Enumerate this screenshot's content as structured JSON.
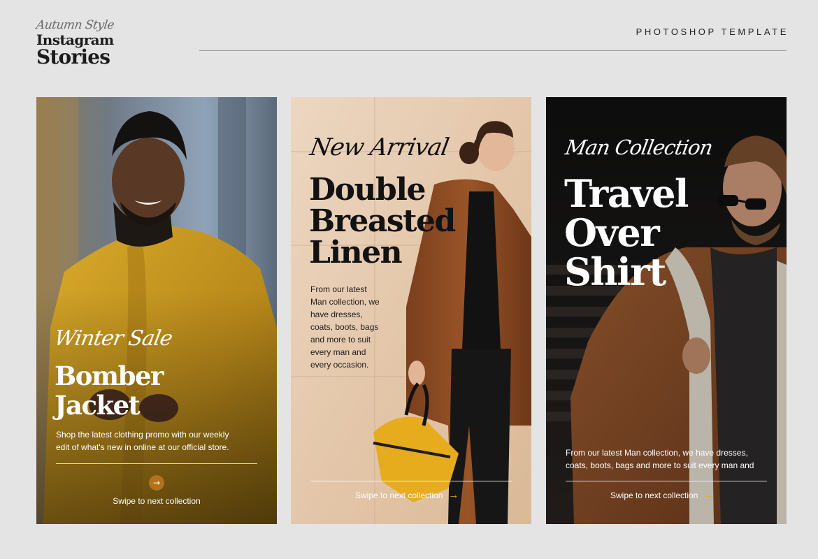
{
  "header": {
    "brand_script": "Autumn Style",
    "brand_line1": "Instagram",
    "brand_line2": "Stories",
    "tag": "PHOTOSHOP TEMPLATE"
  },
  "cards": [
    {
      "script": "Winter Sale",
      "headline": [
        "Bomber",
        "Jacket"
      ],
      "body": [
        "Shop the latest clothing promo with our weekly",
        "edit of what's new in online at our official store."
      ],
      "arrow_icon": "→",
      "swipe": "Swipe to next collection"
    },
    {
      "script": "New Arrival",
      "headline": [
        "Double",
        "Breasted",
        "Linen"
      ],
      "body": [
        "From our latest",
        "Man collection, we",
        "have dresses,",
        "coats, boots, bags",
        "and more to suit",
        "every man and",
        "every occasion."
      ],
      "swipe": "Swipe to next collection",
      "arrow_icon": "→"
    },
    {
      "script": "Man Collection",
      "headline": [
        "Travel",
        "Over",
        "Shirt"
      ],
      "body": [
        "From our latest Man collection, we have dresses,",
        "coats, boots, bags and more to suit every man and"
      ],
      "swipe": "Swipe to next collection",
      "arrow_icon": "→"
    }
  ],
  "colors": {
    "background": "#e4e4e5",
    "accent": "#e7a921",
    "card1_jacket": "#c99a1f",
    "card2_wall": "#e6cdb3",
    "card2_coat": "#8a4a22",
    "card3_background": "#1b1b1b",
    "card3_jacket": "#8b4e2a"
  }
}
